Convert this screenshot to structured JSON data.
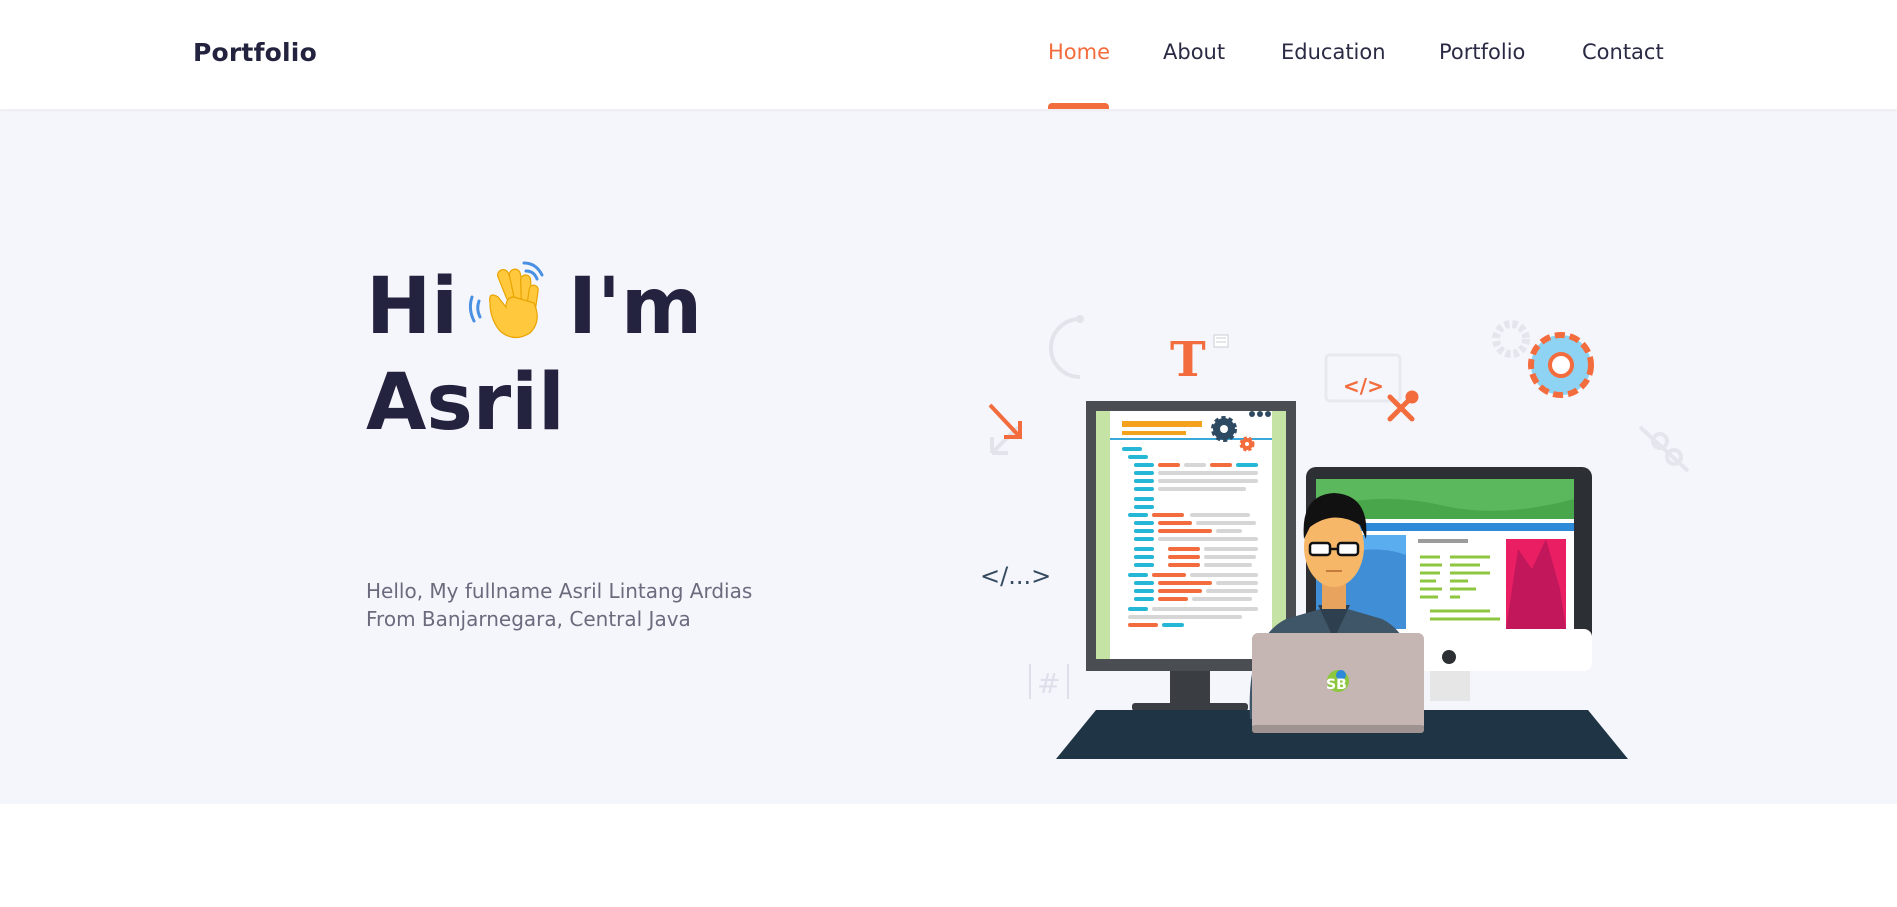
{
  "navbar": {
    "brand": "Portfolio",
    "items": [
      {
        "label": "Home",
        "active": true
      },
      {
        "label": "About",
        "active": false
      },
      {
        "label": "Education",
        "active": false
      },
      {
        "label": "Portfolio",
        "active": false
      },
      {
        "label": "Contact",
        "active": false
      }
    ]
  },
  "hero": {
    "greeting": "Hi",
    "wave_emoji": "waving-hand-icon",
    "im": "I'm",
    "name": "Asril",
    "intro_line1": "Hello, My fullname Asril Lintang Ardias",
    "intro_line2": "From Banjarnegara, Central Java"
  },
  "illustration": {
    "code_tag_1": "</>",
    "code_tag_2": "</...>",
    "hash_symbol": "|#|",
    "letter_t": "T",
    "laptop_logo": "SB"
  },
  "colors": {
    "accent": "#f36c3d",
    "heading": "#23233f",
    "hero_bg": "#f5f6fb",
    "body_text": "#6b6b7e",
    "desk": "#1f3445"
  }
}
